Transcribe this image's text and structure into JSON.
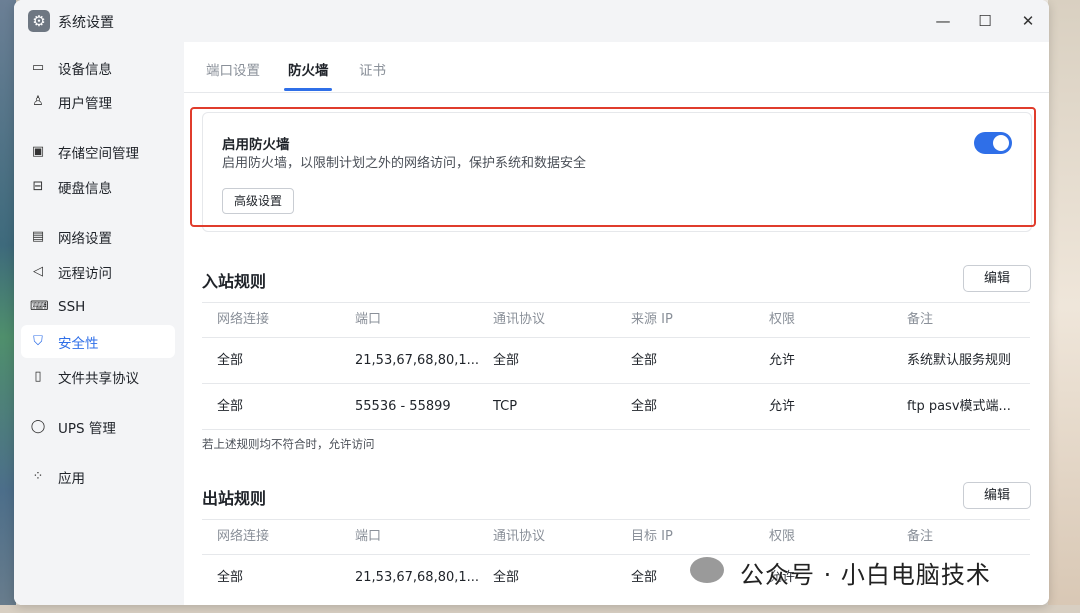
{
  "window": {
    "title": "系统设置"
  },
  "sidebar": {
    "items": [
      {
        "label": "设备信息",
        "icon": "monitor-icon"
      },
      {
        "label": "用户管理",
        "icon": "user-icon"
      },
      {
        "label": "存储空间管理",
        "icon": "storage-icon"
      },
      {
        "label": "硬盘信息",
        "icon": "disk-icon"
      },
      {
        "label": "网络设置",
        "icon": "network-icon"
      },
      {
        "label": "远程访问",
        "icon": "remote-icon"
      },
      {
        "label": "SSH",
        "icon": "terminal-icon"
      },
      {
        "label": "安全性",
        "icon": "shield-icon",
        "active": true
      },
      {
        "label": "文件共享协议",
        "icon": "file-icon"
      },
      {
        "label": "UPS 管理",
        "icon": "ups-icon"
      },
      {
        "label": "应用",
        "icon": "apps-icon"
      }
    ]
  },
  "tabs": [
    {
      "label": "端口设置"
    },
    {
      "label": "防火墙",
      "active": true
    },
    {
      "label": "证书"
    }
  ],
  "firewall": {
    "title": "启用防火墙",
    "description": "启用防火墙，以限制计划之外的网络访问，保护系统和数据安全",
    "advanced_label": "高级设置",
    "enabled": true
  },
  "inbound": {
    "title": "入站规则",
    "edit_label": "编辑",
    "columns": [
      "网络连接",
      "端口",
      "通讯协议",
      "来源 IP",
      "权限",
      "备注"
    ],
    "rows": [
      [
        "全部",
        "21,53,67,68,80,1...",
        "全部",
        "全部",
        "允许",
        "系统默认服务规则"
      ],
      [
        "全部",
        "55536 - 55899",
        "TCP",
        "全部",
        "允许",
        "ftp pasv模式端..."
      ]
    ],
    "footnote": "若上述规则均不符合时，允许访问"
  },
  "outbound": {
    "title": "出站规则",
    "edit_label": "编辑",
    "columns": [
      "网络连接",
      "端口",
      "通讯协议",
      "目标 IP",
      "权限",
      "备注"
    ],
    "rows": [
      [
        "全部",
        "21,53,67,68,80,1...",
        "全部",
        "全部",
        "允许",
        ""
      ]
    ]
  },
  "watermark": "公众号 · 小白电脑技术",
  "colors": {
    "accent": "#2f6fe8",
    "highlight": "#e03c2c"
  }
}
